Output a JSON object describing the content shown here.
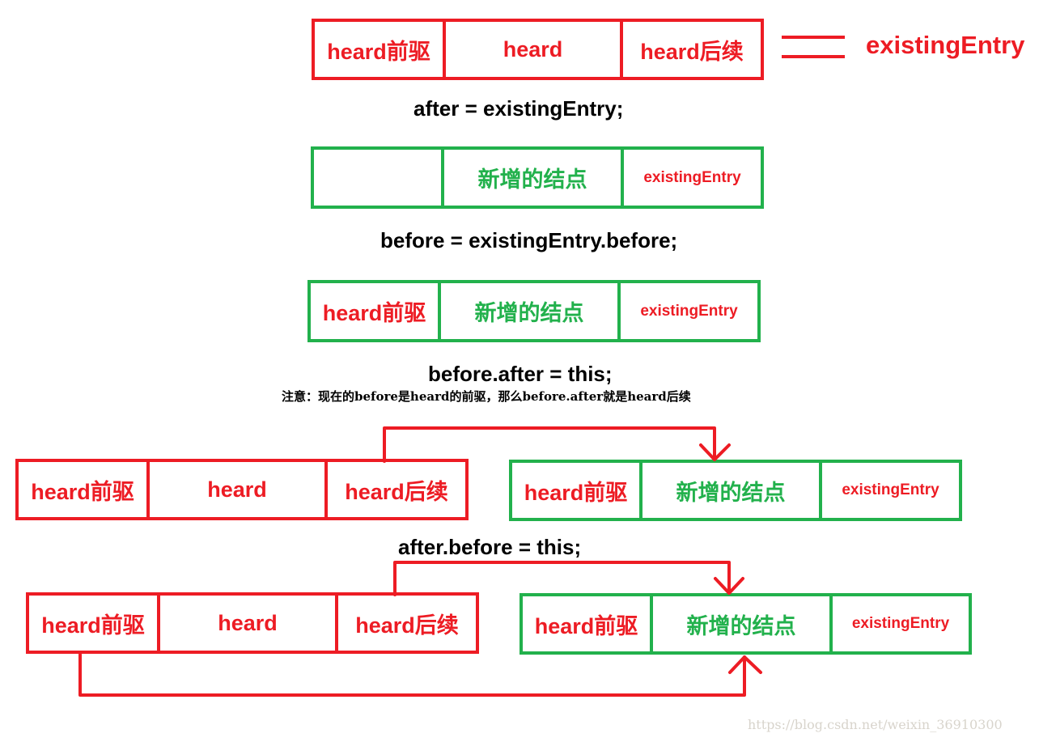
{
  "colors": {
    "red": "#ed1c24",
    "green": "#22b14c",
    "text": "#000000",
    "watermark": "#d8d4cc"
  },
  "legend": {
    "symbol": "equals-sign",
    "label": "existingEntry"
  },
  "labels": {
    "prev": "heard前驱",
    "heard": "heard",
    "next": "heard后续",
    "new_node": "新增的结点",
    "existing": "existingEntry"
  },
  "steps": [
    {
      "code": "after  = existingEntry;"
    },
    {
      "code": "before = existingEntry.before;"
    },
    {
      "code": "before.after = this;",
      "note": "注意：现在的before是heard的前驱，那么before.after就是heard后续"
    },
    {
      "code": "after.before = this;"
    }
  ],
  "watermark": "https://blog.csdn.net/weixin_36910300"
}
